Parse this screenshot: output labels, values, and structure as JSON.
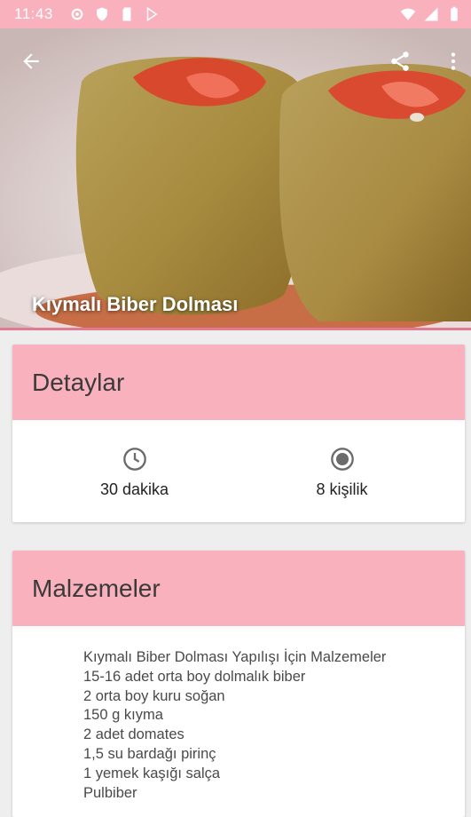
{
  "status_bar": {
    "time": "11:43",
    "left_icons": [
      "gear-icon",
      "shield-icon",
      "sd-card-icon",
      "play-store-icon"
    ],
    "right_icons": [
      "wifi-icon",
      "signal-icon",
      "battery-icon"
    ]
  },
  "header": {
    "title": "Kıymalı Biber Dolması",
    "back_icon": "arrow-back-icon",
    "share_icon": "share-icon",
    "more_icon": "more-vert-icon"
  },
  "details": {
    "title": "Detaylar",
    "time_label": "30 dakika",
    "servings_label": "8 kişilik"
  },
  "ingredients": {
    "title": "Malzemeler",
    "lines": [
      "Kıymalı Biber Dolması Yapılışı İçin Malzemeler",
      "15-16 adet orta boy dolmalık biber",
      "2 orta boy kuru soğan",
      "150 g kıyma",
      "2 adet domates",
      "1,5 su bardağı pirinç",
      "1 yemek kaşığı salça",
      "Pulbiber"
    ]
  },
  "colors": {
    "accent_pink": "#f9b1bd",
    "underline": "#e27a93"
  }
}
